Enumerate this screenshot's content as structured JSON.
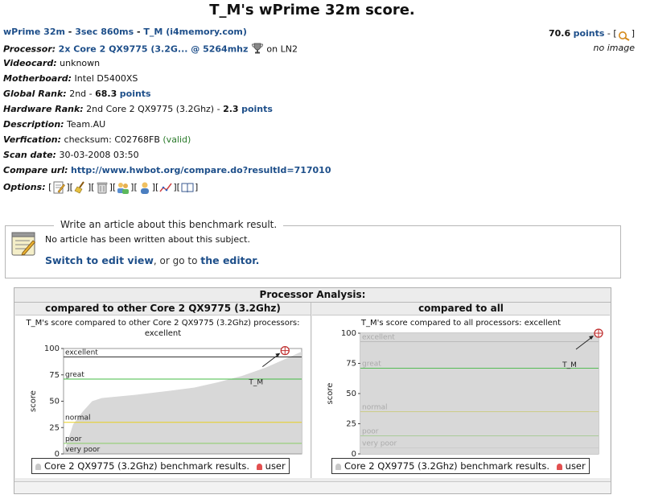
{
  "page_title": "T_M's wPrime 32m score.",
  "subtitle": {
    "benchmark": "wPrime 32m",
    "dash1": " - ",
    "score": "3sec 860ms",
    "dash2": " - ",
    "user": "T_M",
    "source": " (i4memory.com)"
  },
  "points_box": {
    "value": "70.6",
    "points_label": "points",
    "sep": " - [",
    "close": "]",
    "no_image": "no image"
  },
  "details": {
    "processor": {
      "label": "Processor:",
      "value": "2x Core 2 QX9775 (3.2G... @ 5264mhz",
      "suffix": " on LN2"
    },
    "videocard": {
      "label": "Videocard:",
      "value": "unknown"
    },
    "motherboard": {
      "label": "Motherboard:",
      "value": "Intel D5400XS"
    },
    "global_rank": {
      "label": "Global Rank:",
      "prefix": "2nd - ",
      "points": "68.3",
      "points_label": "points"
    },
    "hardware_rank": {
      "label": "Hardware Rank:",
      "prefix": "2nd Core 2 QX9775 (3.2Ghz) - ",
      "points": "2.3",
      "points_label": "points"
    },
    "description": {
      "label": "Description:",
      "value": "Team.AU"
    },
    "verification": {
      "label": "Verfication:",
      "value": "checksum: C02768FB",
      "status": "(valid)"
    },
    "scan_date": {
      "label": "Scan date:",
      "value": "30-03-2008 03:50"
    },
    "compare_url": {
      "label": "Compare url:",
      "value": "http://www.hwbot.org/compare.do?resultId=717010"
    },
    "options": {
      "label": "Options:",
      "open": "[",
      "sep": "][",
      "close": "]",
      "icons": [
        "edit-icon",
        "broom-icon",
        "delete-icon",
        "users-icon",
        "user-icon",
        "graph-icon",
        "book-icon"
      ]
    }
  },
  "article": {
    "legend": "Write an article about this benchmark result.",
    "message": "No article has been written about this subject.",
    "edit_link": "Switch to edit view",
    "middle": ", or go to ",
    "editor_link": "the editor."
  },
  "analysis": {
    "title": "Processor Analysis:",
    "left": {
      "title": "compared to other Core 2 QX9775 (3.2Ghz)",
      "desc_line1": "T_M's score compared to other Core 2 QX9775 (3.2Ghz) processors:",
      "desc_line2": "excellent",
      "legend_series": "Core 2 QX9775 (3.2Ghz) benchmark results.",
      "legend_user": "user"
    },
    "right": {
      "title": "compared to all",
      "desc_line1": "T_M's score compared to all processors: excellent",
      "legend_series": "Core 2 QX9775 (3.2Ghz) benchmark results.",
      "legend_user": "user"
    }
  },
  "chart_data": [
    {
      "type": "area",
      "ylabel": "score",
      "ylim": [
        0,
        100
      ],
      "yticks": [
        0,
        25,
        50,
        75,
        100
      ],
      "bands": [
        {
          "label": "excellent",
          "y": 92,
          "color": "#333333"
        },
        {
          "label": "great",
          "y": 71,
          "color": "#44bb44"
        },
        {
          "label": "normal",
          "y": 30,
          "color": "#e8d020"
        },
        {
          "label": "poor",
          "y": 10,
          "color": "#88cc66"
        },
        {
          "label": "very poor",
          "y": 0,
          "color": "#999999"
        }
      ],
      "series": [
        {
          "name": "Core 2 QX9775 (3.2Ghz) benchmark results.",
          "x": [
            0,
            0.04,
            0.08,
            0.12,
            0.16,
            0.3,
            0.45,
            0.55,
            0.65,
            0.75,
            0.85,
            0.93,
            1.0
          ],
          "y": [
            0,
            28,
            40,
            50,
            53,
            56,
            60,
            63,
            68,
            74,
            82,
            90,
            97
          ]
        }
      ],
      "user": {
        "label": "T_M",
        "x": 0.93,
        "y": 98
      }
    },
    {
      "type": "area",
      "ylabel": "score",
      "ylim": [
        0,
        100
      ],
      "yticks": [
        0,
        25,
        50,
        75,
        100
      ],
      "bands": [
        {
          "label": "excellent",
          "y": 93,
          "color": "#bbbbbb"
        },
        {
          "label": "great",
          "y": 71,
          "color": "#55bb55"
        },
        {
          "label": "normal",
          "y": 35,
          "color": "#cccc88"
        },
        {
          "label": "poor",
          "y": 15,
          "color": "#aacc99"
        },
        {
          "label": "very poor",
          "y": 5,
          "color": "#cccccc"
        }
      ],
      "series": [
        {
          "name": "Core 2 QX9775 (3.2Ghz) benchmark results.",
          "x": [
            0,
            1
          ],
          "y": [
            100,
            100
          ]
        }
      ],
      "user": {
        "label": "T_M",
        "x": 1.0,
        "y": 100
      }
    }
  ]
}
